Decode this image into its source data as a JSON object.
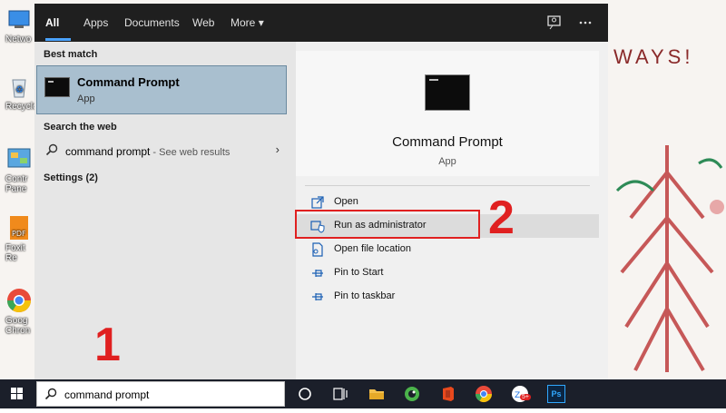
{
  "desktop": {
    "wallpaper_text": "WAYS!",
    "icons": [
      {
        "label": "Netwo",
        "icon": "network-icon"
      },
      {
        "label": "Recycle",
        "icon": "recycle-bin-icon"
      },
      {
        "label": "Contr Pane",
        "icon": "control-panel-icon"
      },
      {
        "label": "Foxit Re",
        "icon": "foxit-pdf-icon"
      },
      {
        "label": "Goog Chron",
        "icon": "chrome-icon"
      }
    ]
  },
  "search_panel": {
    "tabs": [
      {
        "label": "All",
        "active": true
      },
      {
        "label": "Apps"
      },
      {
        "label": "Documents"
      },
      {
        "label": "Web"
      },
      {
        "label": "More"
      }
    ],
    "more_caret": "▾",
    "tab_icons": [
      "feedback-icon",
      "more-options-icon"
    ],
    "left": {
      "best_match_title": "Best match",
      "best_match": {
        "name": "Command Prompt",
        "type": "App"
      },
      "search_web_title": "Search the web",
      "web_result": {
        "query": "command prompt",
        "suffix": " - See web results"
      },
      "settings_title": "Settings (2)"
    },
    "right": {
      "app_name": "Command Prompt",
      "app_type": "App",
      "actions": [
        {
          "label": "Open",
          "icon": "open-icon"
        },
        {
          "label": "Run as administrator",
          "icon": "run-as-admin-icon",
          "highlighted": true
        },
        {
          "label": "Open file location",
          "icon": "file-location-icon"
        },
        {
          "label": "Pin to Start",
          "icon": "pin-icon"
        },
        {
          "label": "Pin to taskbar",
          "icon": "pin-icon"
        }
      ]
    }
  },
  "callouts": {
    "one": "1",
    "two": "2"
  },
  "taskbar": {
    "search_value": "command prompt",
    "apps": [
      "cortana-icon",
      "task-view-icon",
      "file-explorer-icon",
      "coccoc-icon",
      "office-icon",
      "chrome-icon",
      "zalo-icon",
      "photoshop-icon"
    ],
    "zalo_badge": "5+",
    "photoshop_label": "Ps"
  },
  "colors": {
    "callout": "#e02020",
    "accent": "#4aa3ff",
    "best_match_bg": "#a9bfcf"
  }
}
